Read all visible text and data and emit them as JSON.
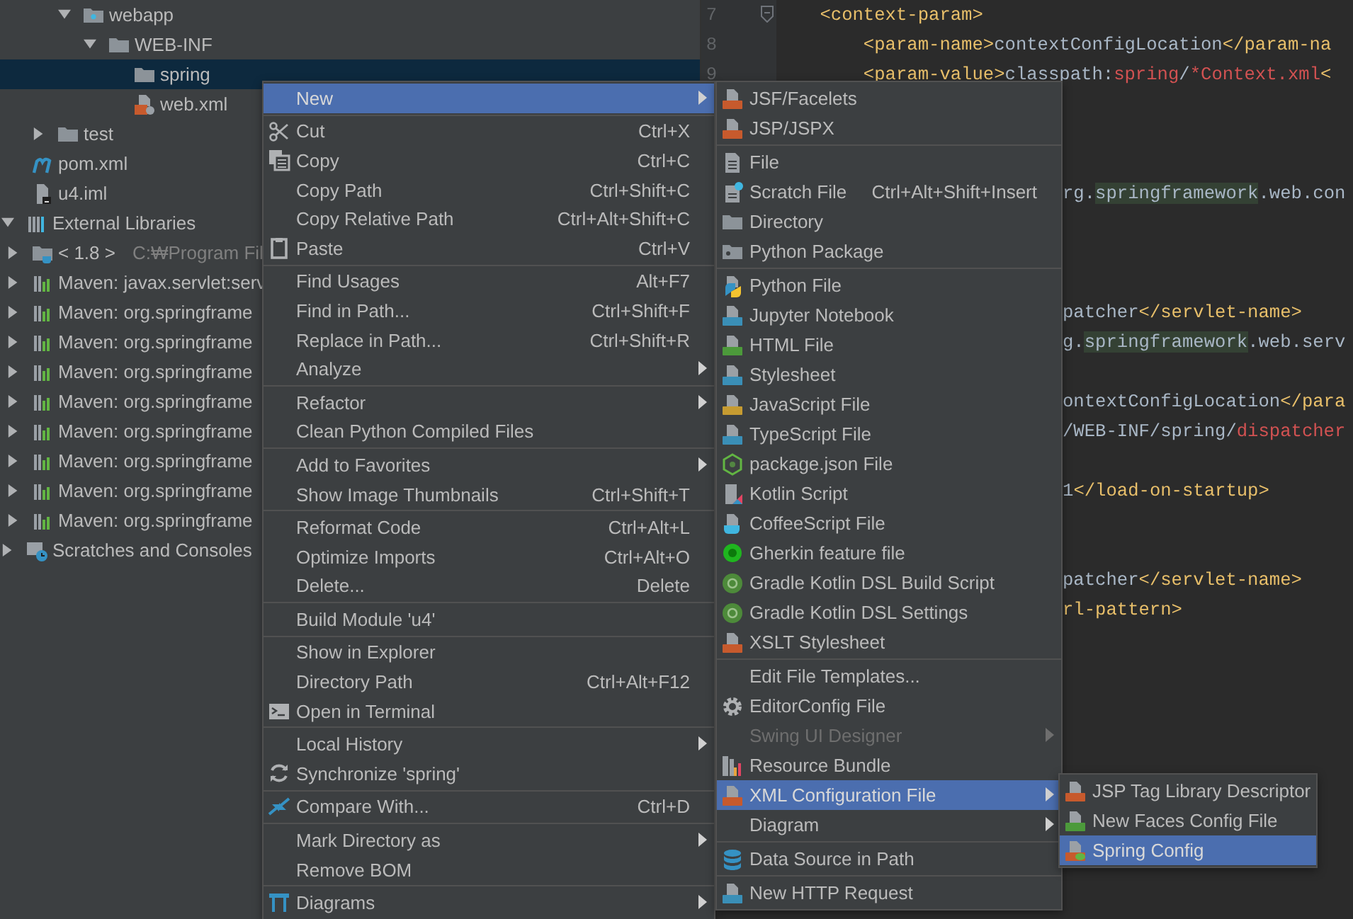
{
  "tree": {
    "items": [
      {
        "kind": "offscreen",
        "children": [
          {
            "kind": "offscreen",
            "children": [
              {
                "kind": "offscreen",
                "children": [
                  {
                    "label": "webapp",
                    "kind": "web-folder",
                    "expanded": true,
                    "selected": false,
                    "children": [
                      {
                        "label": "WEB-INF",
                        "kind": "folder",
                        "expanded": true,
                        "selected": false,
                        "children": [
                          {
                            "label": "spring",
                            "kind": "folder",
                            "selected": true
                          },
                          {
                            "label": "web.xml",
                            "kind": "xml-file",
                            "selected": false
                          }
                        ]
                      }
                    ]
                  }
                ]
              },
              {
                "label": "test",
                "kind": "folder",
                "expanded": false,
                "selected": false
              }
            ]
          },
          {
            "label": "pom.xml",
            "kind": "pom",
            "selected": false
          },
          {
            "label": "u4.iml",
            "kind": "iml",
            "selected": false
          }
        ]
      },
      {
        "label": "External Libraries",
        "kind": "libraries",
        "expanded": true,
        "selected": false,
        "children": [
          {
            "label": "< 1.8 >",
            "detail": "C:₩Program Fil",
            "kind": "jdk",
            "expanded": false,
            "selected": false
          },
          {
            "label": "Maven: javax.servlet:serv",
            "kind": "maven-lib",
            "expanded": false,
            "selected": false
          },
          {
            "label": "Maven: org.springframe",
            "kind": "maven-lib",
            "expanded": false,
            "selected": false
          },
          {
            "label": "Maven: org.springframe",
            "kind": "maven-lib",
            "expanded": false,
            "selected": false
          },
          {
            "label": "Maven: org.springframe",
            "kind": "maven-lib",
            "expanded": false,
            "selected": false
          },
          {
            "label": "Maven: org.springframe",
            "kind": "maven-lib",
            "expanded": false,
            "selected": false
          },
          {
            "label": "Maven: org.springframe",
            "kind": "maven-lib",
            "expanded": false,
            "selected": false
          },
          {
            "label": "Maven: org.springframe",
            "kind": "maven-lib",
            "expanded": false,
            "selected": false
          },
          {
            "label": "Maven: org.springframe",
            "kind": "maven-lib",
            "expanded": false,
            "selected": false
          },
          {
            "label": "Maven: org.springframe",
            "kind": "maven-lib",
            "expanded": false,
            "selected": false
          }
        ]
      },
      {
        "label": "Scratches and Consoles",
        "kind": "scratches",
        "expanded": false,
        "selected": false
      }
    ]
  },
  "editor": {
    "lines": [
      {
        "kind": "full",
        "number": "7",
        "foldable": true,
        "segments": [
          {
            "kind": "tag",
            "text": "    <context-param>"
          }
        ]
      },
      {
        "kind": "full",
        "number": "8",
        "segments": [
          {
            "kind": "tag",
            "text": "        <param-name>"
          },
          {
            "kind": "text",
            "text": "contextConfigLocation"
          },
          {
            "kind": "tag",
            "text": "</param-na"
          }
        ]
      },
      {
        "kind": "full",
        "number": "9",
        "segments": [
          {
            "kind": "tag",
            "text": "        <param-value>"
          },
          {
            "kind": "text",
            "text": "classpath:"
          },
          {
            "kind": "string",
            "text": "spring"
          },
          {
            "kind": "text",
            "text": "/"
          },
          {
            "kind": "string",
            "text": "*Context.xml"
          },
          {
            "kind": "tag",
            "text": "<"
          }
        ]
      },
      {
        "kind": "blank"
      },
      {
        "kind": "blank"
      },
      {
        "kind": "blank"
      },
      {
        "kind": "partial",
        "segments": [
          {
            "kind": "text",
            "text": "rg."
          },
          {
            "kind": "match",
            "text": "springframework"
          },
          {
            "kind": "text",
            "text": ".web.con"
          }
        ]
      },
      {
        "kind": "blank"
      },
      {
        "kind": "blank"
      },
      {
        "kind": "blank"
      },
      {
        "kind": "partial",
        "segments": [
          {
            "kind": "text",
            "text": "patcher"
          },
          {
            "kind": "tag",
            "text": "</servlet-name>"
          }
        ]
      },
      {
        "kind": "partial",
        "segments": [
          {
            "kind": "text",
            "text": "g."
          },
          {
            "kind": "match",
            "text": "springframework"
          },
          {
            "kind": "text",
            "text": ".web.serv"
          }
        ]
      },
      {
        "kind": "blank"
      },
      {
        "kind": "partial",
        "segments": [
          {
            "kind": "text",
            "text": "ontextConfigLocation"
          },
          {
            "kind": "tag",
            "text": "</para"
          }
        ]
      },
      {
        "kind": "partial",
        "segments": [
          {
            "kind": "text",
            "text": "/WEB-INF/spring/"
          },
          {
            "kind": "string",
            "text": "dispatcher"
          }
        ]
      },
      {
        "kind": "blank"
      },
      {
        "kind": "partial",
        "segments": [
          {
            "kind": "text",
            "text": "1"
          },
          {
            "kind": "tag",
            "text": "</load-on-startup>"
          }
        ]
      },
      {
        "kind": "blank"
      },
      {
        "kind": "blank"
      },
      {
        "kind": "partial",
        "segments": [
          {
            "kind": "text",
            "text": "patcher"
          },
          {
            "kind": "tag",
            "text": "</servlet-name>"
          }
        ]
      },
      {
        "kind": "partial",
        "segments": [
          {
            "kind": "tag",
            "text": "rl-pattern>"
          }
        ]
      }
    ]
  },
  "context_menu": {
    "items": [
      {
        "kind": "plain",
        "label": "New",
        "selected": true,
        "submenu": true
      },
      {
        "kind": "separator"
      },
      {
        "kind": "cut",
        "label": "Cut",
        "shortcut": "Ctrl+X",
        "selected": false,
        "submenu": false
      },
      {
        "kind": "copy",
        "label": "Copy",
        "shortcut": "Ctrl+C",
        "selected": false,
        "submenu": false
      },
      {
        "kind": "plain",
        "label": "Copy Path",
        "shortcut": "Ctrl+Shift+C",
        "selected": false,
        "submenu": false
      },
      {
        "kind": "plain",
        "label": "Copy Relative Path",
        "shortcut": "Ctrl+Alt+Shift+C",
        "selected": false,
        "submenu": false
      },
      {
        "kind": "paste",
        "label": "Paste",
        "shortcut": "Ctrl+V",
        "selected": false,
        "submenu": false
      },
      {
        "kind": "separator"
      },
      {
        "kind": "plain",
        "label": "Find Usages",
        "shortcut": "Alt+F7",
        "selected": false,
        "submenu": false
      },
      {
        "kind": "plain",
        "label": "Find in Path...",
        "shortcut": "Ctrl+Shift+F",
        "selected": false,
        "submenu": false
      },
      {
        "kind": "plain",
        "label": "Replace in Path...",
        "shortcut": "Ctrl+Shift+R",
        "selected": false,
        "submenu": false
      },
      {
        "kind": "plain",
        "label": "Analyze",
        "selected": false,
        "submenu": true
      },
      {
        "kind": "separator"
      },
      {
        "kind": "plain",
        "label": "Refactor",
        "selected": false,
        "submenu": true
      },
      {
        "kind": "plain",
        "label": "Clean Python Compiled Files",
        "selected": false,
        "submenu": false
      },
      {
        "kind": "separator"
      },
      {
        "kind": "plain",
        "label": "Add to Favorites",
        "selected": false,
        "submenu": true
      },
      {
        "kind": "plain",
        "label": "Show Image Thumbnails",
        "shortcut": "Ctrl+Shift+T",
        "selected": false,
        "submenu": false
      },
      {
        "kind": "separator"
      },
      {
        "kind": "plain",
        "label": "Reformat Code",
        "shortcut": "Ctrl+Alt+L",
        "selected": false,
        "submenu": false
      },
      {
        "kind": "plain",
        "label": "Optimize Imports",
        "shortcut": "Ctrl+Alt+O",
        "selected": false,
        "submenu": false
      },
      {
        "kind": "plain",
        "label": "Delete...",
        "shortcut": "Delete",
        "selected": false,
        "submenu": false
      },
      {
        "kind": "separator"
      },
      {
        "kind": "plain",
        "label": "Build Module 'u4'",
        "selected": false,
        "submenu": false
      },
      {
        "kind": "separator"
      },
      {
        "kind": "plain",
        "label": "Show in Explorer",
        "selected": false,
        "submenu": false
      },
      {
        "kind": "plain",
        "label": "Directory Path",
        "shortcut": "Ctrl+Alt+F12",
        "selected": false,
        "submenu": false
      },
      {
        "kind": "terminal",
        "label": "Open in Terminal",
        "selected": false,
        "submenu": false
      },
      {
        "kind": "separator"
      },
      {
        "kind": "plain",
        "label": "Local History",
        "selected": false,
        "submenu": true
      },
      {
        "kind": "sync",
        "label": "Synchronize 'spring'",
        "selected": false,
        "submenu": false
      },
      {
        "kind": "separator"
      },
      {
        "kind": "compare",
        "label": "Compare With...",
        "shortcut": "Ctrl+D",
        "selected": false,
        "submenu": false
      },
      {
        "kind": "separator"
      },
      {
        "kind": "plain",
        "label": "Mark Directory as",
        "selected": false,
        "submenu": true
      },
      {
        "kind": "plain",
        "label": "Remove BOM",
        "selected": false,
        "submenu": false
      },
      {
        "kind": "separator"
      },
      {
        "kind": "diagrams",
        "label": "Diagrams",
        "selected": false,
        "submenu": true
      }
    ]
  },
  "new_submenu": {
    "items": [
      {
        "kind": "jsf",
        "label": "JSF/Facelets",
        "selected": false,
        "submenu": false,
        "disabled": false
      },
      {
        "kind": "jsp",
        "label": "JSP/JSPX",
        "selected": false,
        "submenu": false,
        "disabled": false
      },
      {
        "kind": "separator"
      },
      {
        "kind": "file",
        "label": "File",
        "selected": false,
        "submenu": false,
        "disabled": false
      },
      {
        "kind": "scratch",
        "label": "Scratch File",
        "shortcut": "Ctrl+Alt+Shift+Insert",
        "selected": false,
        "submenu": false,
        "disabled": false
      },
      {
        "kind": "folder",
        "label": "Directory",
        "selected": false,
        "submenu": false,
        "disabled": false
      },
      {
        "kind": "package",
        "label": "Python Package",
        "selected": false,
        "submenu": false,
        "disabled": false
      },
      {
        "kind": "separator"
      },
      {
        "kind": "python",
        "label": "Python File",
        "selected": false,
        "submenu": false,
        "disabled": false
      },
      {
        "kind": "jupyter",
        "label": "Jupyter Notebook",
        "selected": false,
        "submenu": false,
        "disabled": false
      },
      {
        "kind": "html",
        "label": "HTML File",
        "selected": false,
        "submenu": false,
        "disabled": false
      },
      {
        "kind": "css",
        "label": "Stylesheet",
        "selected": false,
        "submenu": false,
        "disabled": false
      },
      {
        "kind": "js",
        "label": "JavaScript File",
        "selected": false,
        "submenu": false,
        "disabled": false
      },
      {
        "kind": "ts",
        "label": "TypeScript File",
        "selected": false,
        "submenu": false,
        "disabled": false
      },
      {
        "kind": "nodejs",
        "label": "package.json File",
        "selected": false,
        "submenu": false,
        "disabled": false
      },
      {
        "kind": "kotlin",
        "label": "Kotlin Script",
        "selected": false,
        "submenu": false,
        "disabled": false
      },
      {
        "kind": "coffee",
        "label": "CoffeeScript File",
        "selected": false,
        "submenu": false,
        "disabled": false
      },
      {
        "kind": "gherkin",
        "label": "Gherkin feature file",
        "selected": false,
        "submenu": false,
        "disabled": false
      },
      {
        "kind": "gradle",
        "label": "Gradle Kotlin DSL Build Script",
        "selected": false,
        "submenu": false,
        "disabled": false
      },
      {
        "kind": "gradle",
        "label": "Gradle Kotlin DSL Settings",
        "selected": false,
        "submenu": false,
        "disabled": false
      },
      {
        "kind": "xslt",
        "label": "XSLT Stylesheet",
        "selected": false,
        "submenu": false,
        "disabled": false
      },
      {
        "kind": "separator"
      },
      {
        "kind": "plain",
        "label": "Edit File Templates...",
        "selected": false,
        "submenu": false,
        "disabled": false
      },
      {
        "kind": "gear",
        "label": "EditorConfig File",
        "selected": false,
        "submenu": false,
        "disabled": false
      },
      {
        "kind": "plain",
        "label": "Swing UI Designer",
        "selected": false,
        "submenu": true,
        "disabled": true
      },
      {
        "kind": "bundle",
        "label": "Resource Bundle",
        "selected": false,
        "submenu": false,
        "disabled": false
      },
      {
        "kind": "xml",
        "label": "XML Configuration File",
        "selected": true,
        "submenu": true,
        "disabled": false
      },
      {
        "kind": "plain",
        "label": "Diagram",
        "selected": false,
        "submenu": true,
        "disabled": false
      },
      {
        "kind": "separator"
      },
      {
        "kind": "database",
        "label": "Data Source in Path",
        "selected": false,
        "submenu": false,
        "disabled": false
      },
      {
        "kind": "separator"
      },
      {
        "kind": "api",
        "label": "New HTTP Request",
        "selected": false,
        "submenu": false,
        "disabled": false
      }
    ]
  },
  "xml_submenu": {
    "items": [
      {
        "kind": "xml",
        "label": "JSP Tag Library Descriptor",
        "selected": false,
        "submenu": false
      },
      {
        "kind": "faces",
        "label": "New Faces Config File",
        "selected": false,
        "submenu": false
      },
      {
        "kind": "spring",
        "label": "Spring Config",
        "selected": true,
        "submenu": false
      }
    ]
  }
}
